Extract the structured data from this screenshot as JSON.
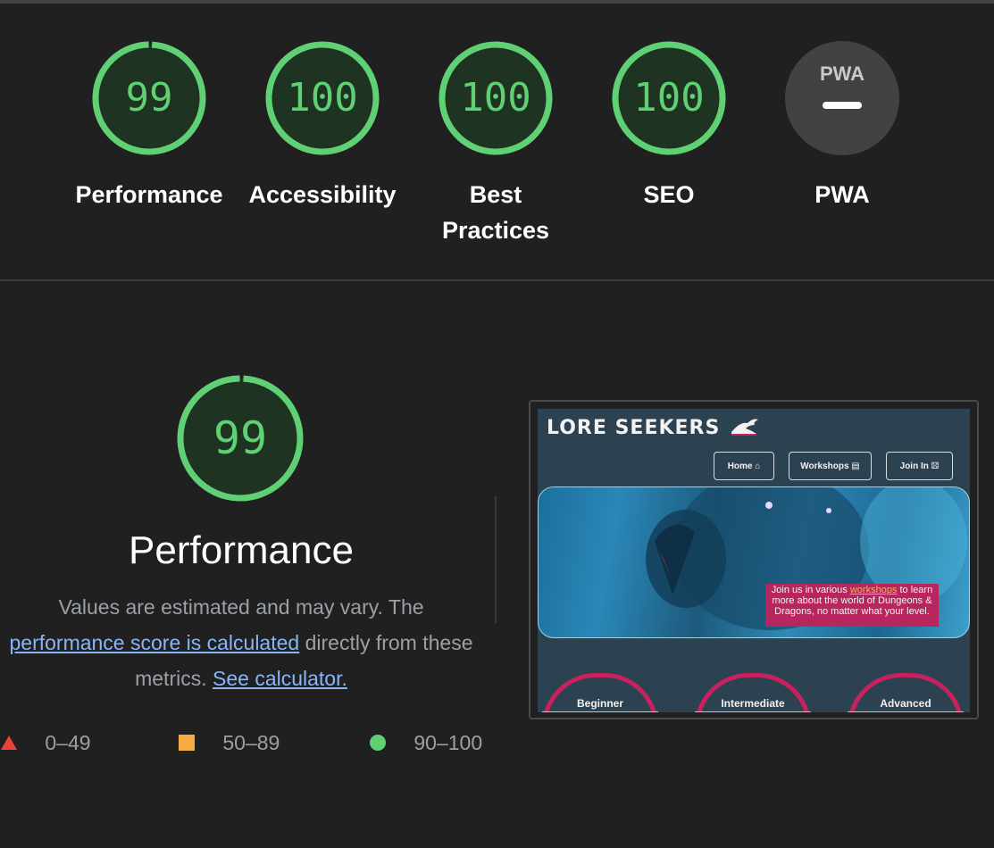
{
  "colors": {
    "pass": "#5fd073",
    "pass_bg": "#1f3323",
    "na_bg": "#424242",
    "background": "#202020",
    "link": "#8ab4f8",
    "fail": "#e94335",
    "average": "#f4ad42"
  },
  "categories": [
    {
      "name": "performance",
      "score": "99",
      "value": 99,
      "label": "Performance"
    },
    {
      "name": "accessibility",
      "score": "100",
      "value": 100,
      "label": "Accessibility"
    },
    {
      "name": "best-practices",
      "score": "100",
      "value": 100,
      "label": "Best Practices"
    },
    {
      "name": "seo",
      "score": "100",
      "value": 100,
      "label": "SEO"
    },
    {
      "name": "pwa",
      "score": "",
      "badge": "PWA",
      "label": "PWA"
    }
  ],
  "performance": {
    "score": "99",
    "value": 99,
    "title": "Performance",
    "desc_prefix": "Values are estimated and may vary. The",
    "desc_link": "performance score is calculated",
    "desc_middle": "directly from these metrics.",
    "calc_link": "See calculator."
  },
  "legend": [
    {
      "icon": "triangle-icon",
      "range": "0–49"
    },
    {
      "icon": "square-icon",
      "range": "50–89"
    },
    {
      "icon": "circle-icon",
      "range": "90–100"
    }
  ],
  "screenshot": {
    "logo": "LORE SEEKERS",
    "nav": [
      "Home",
      "Workshops",
      "Join In"
    ],
    "hero_prefix": "Join us in various",
    "hero_link": "workshops",
    "hero_suffix": "to learn more about the world of Dungeons & Dragons, no matter what your level.",
    "levels": [
      "Beginner",
      "Intermediate",
      "Advanced"
    ]
  }
}
